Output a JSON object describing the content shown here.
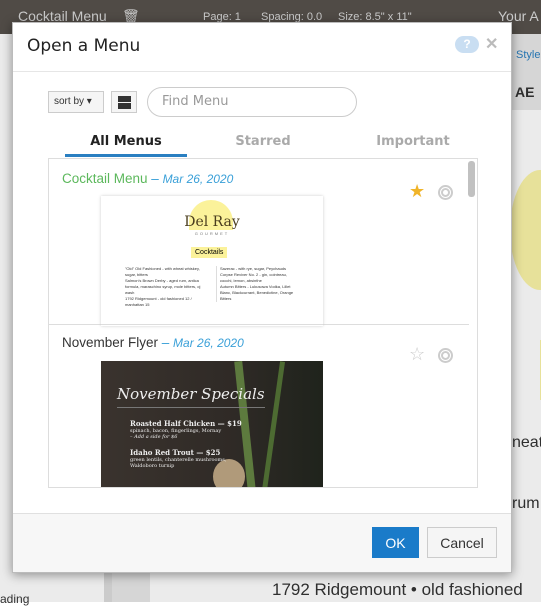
{
  "topbar": {
    "doc_title": "Cocktail Menu",
    "page": "Page: 1",
    "spacing": "Spacing: 0.0",
    "size": "Size: 8.5\" x 11\"",
    "account": "Your A"
  },
  "background": {
    "style_link": "Style",
    "toolbar_glyph": "AE",
    "line1": "neat",
    "line2": "rum",
    "line3": "1792 Ridgemount • old fashioned",
    "sidebar_bottom": "ading"
  },
  "dialog": {
    "title": "Open a Menu",
    "help": "?",
    "close": "✕",
    "sort_label": "sort by ▾",
    "search_placeholder": "Find Menu",
    "tabs": [
      {
        "label": "All Menus",
        "active": true
      },
      {
        "label": "Starred"
      },
      {
        "label": "Important"
      }
    ],
    "items": [
      {
        "name": "Cocktail Menu",
        "separator": " – ",
        "date": "Mar 26, 2020",
        "starred": true,
        "name_color": "#5cb85c",
        "thumb": {
          "logo": "Del Ray",
          "logo_sub": "GOURMET",
          "heading": "Cocktails",
          "left": [
            "\"Old\" Old Fashioned - with wheat whiskey, sugar, bitters",
            "Salmon's Brown Derby - aged rum, antica formula, maraschino syrup, mole bitters, oj wash",
            "1792 Ridgemount - old fashioned 12 / manhattan 15"
          ],
          "right": [
            "Sazerac - with rye, sugar, Peychauds",
            "Corpse Reviver No. 2 - gin, cointreau, cocchi, lemon, absinthe",
            "Autumn Bitters - Lukusowa Vodka, Lillet Blanc, Blackcurrant, Benedictine, Orange Bitters"
          ]
        }
      },
      {
        "name": "November Flyer",
        "separator": " – ",
        "date": "Mar 26, 2020",
        "starred": false,
        "name_color": "#333333",
        "thumb": {
          "heading": "November Specials",
          "dish1": "Roasted Half Chicken — $19",
          "dish1_desc": "spinach, bacon, fingerlings, Mornay",
          "dish1_note": "– Add a side for $6",
          "dish2": "Idaho Red Trout — $25",
          "dish2_desc": "green lentils, chanterelle mushrooms, Waldoboro turnip"
        }
      }
    ],
    "ok": "OK",
    "cancel": "Cancel"
  },
  "colors": {
    "accent": "#1a7bc9",
    "star": "#f0b429",
    "date": "#3aa0d8",
    "topbar": "#57524d"
  }
}
